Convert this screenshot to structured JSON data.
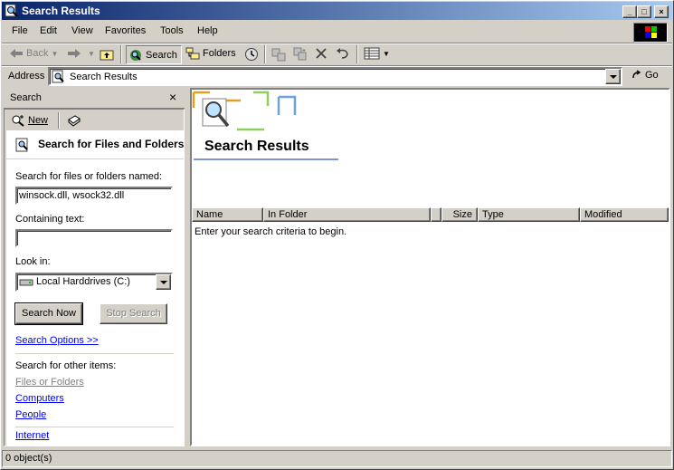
{
  "window": {
    "title": "Search Results",
    "controls": {
      "minimize": "_",
      "maximize": "□",
      "close": "×"
    }
  },
  "menu": [
    "File",
    "Edit",
    "View",
    "Favorites",
    "Tools",
    "Help"
  ],
  "toolbar": {
    "back_label": "Back",
    "search_label": "Search",
    "folders_label": "Folders"
  },
  "address": {
    "label": "Address",
    "value": "Search Results",
    "go_label": "Go"
  },
  "search_pane": {
    "title": "Search",
    "new_label": "New",
    "heading": "Search for Files and Folders",
    "named_label": "Search for files or folders named:",
    "named_value": "winsock.dll, wsock32.dll",
    "containing_label": "Containing text:",
    "containing_value": "",
    "lookin_label": "Look in:",
    "lookin_value": "Local Harddrives (C:)",
    "search_now_label": "Search Now",
    "stop_search_label": "Stop Search",
    "options_link": "Search Options >>",
    "other_items_label": "Search for other items:",
    "other_items": [
      {
        "label": "Files or Folders",
        "enabled": false
      },
      {
        "label": "Computers",
        "enabled": true
      },
      {
        "label": "People",
        "enabled": true
      }
    ],
    "internet_link": "Internet"
  },
  "results": {
    "banner_title": "Search Results",
    "columns": [
      "Name",
      "In Folder",
      "Size",
      "Type",
      "Modified"
    ],
    "empty_message": "Enter your search criteria to begin."
  },
  "status": {
    "text": "0 object(s)"
  },
  "colors": {
    "title_start": "#0a246a",
    "title_end": "#a6caf0",
    "link": "#0000ff",
    "face": "#d4d0c8"
  }
}
